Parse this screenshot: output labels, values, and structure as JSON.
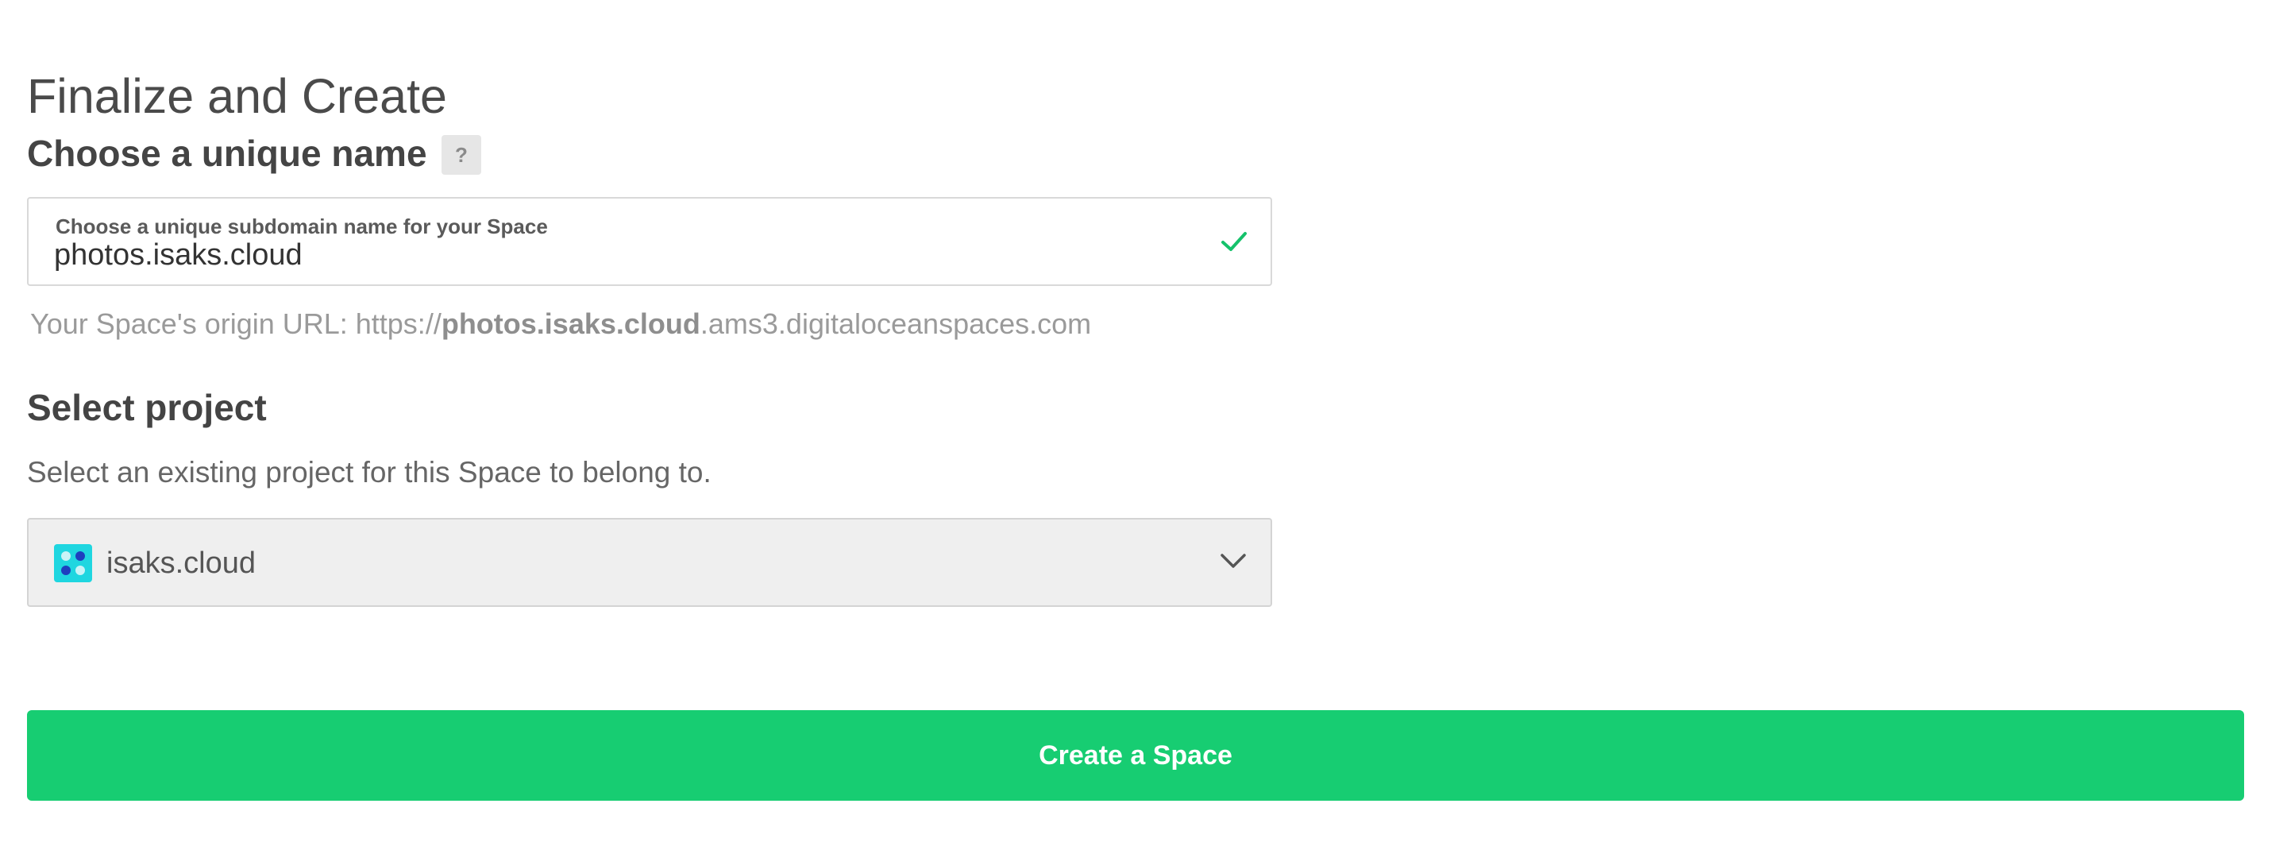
{
  "page": {
    "title": "Finalize and Create"
  },
  "name_section": {
    "heading": "Choose a unique name",
    "help_label": "?",
    "field_label": "Choose a unique subdomain name for your Space",
    "field_value": "photos.isaks.cloud",
    "validation_icon": "check-icon",
    "origin_prefix": "Your Space's origin URL: https://",
    "origin_subdomain": "photos.isaks.cloud",
    "origin_suffix": ".ams3.digitaloceanspaces.com"
  },
  "project_section": {
    "heading": "Select project",
    "description": "Select an existing project for this Space to belong to.",
    "selected_project": "isaks.cloud",
    "project_icon": "project-icon",
    "dropdown_icon": "chevron-down-icon"
  },
  "actions": {
    "create_label": "Create a Space"
  },
  "colors": {
    "accent_green": "#17cd72",
    "check_green": "#15c26b",
    "project_icon_bg": "#1fd6e0",
    "project_icon_dots_dark": "#1e3fbf",
    "project_icon_dots_light": "#c9f3f7"
  }
}
